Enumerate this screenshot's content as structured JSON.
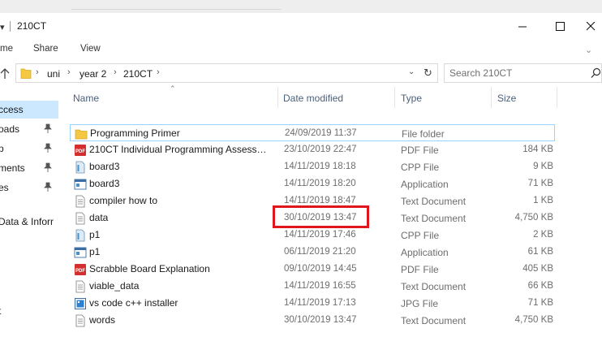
{
  "window": {
    "title": "210CT",
    "qa_arrow": "▾"
  },
  "ribbon": {
    "tabs": [
      "me",
      "Share",
      "View"
    ]
  },
  "address": {
    "crumbs": [
      "uni",
      "year 2",
      "210CT"
    ]
  },
  "search": {
    "placeholder": "Search 210CT"
  },
  "nav": {
    "items": [
      {
        "label": "ccess",
        "selected": true,
        "pinned": false
      },
      {
        "label": "oads",
        "selected": false,
        "pinned": true
      },
      {
        "label": "p",
        "selected": false,
        "pinned": true
      },
      {
        "label": "ments",
        "selected": false,
        "pinned": true
      },
      {
        "label": "es",
        "selected": false,
        "pinned": true
      },
      {
        "label": "Data & Inforr",
        "selected": false,
        "pinned": false
      },
      {
        "label": "t",
        "selected": false,
        "pinned": false
      }
    ]
  },
  "columns": {
    "name": "Name",
    "date": "Date modified",
    "type": "Type",
    "size": "Size"
  },
  "files": [
    {
      "name": "Programming Primer",
      "date": "24/09/2019 11:37",
      "type": "File folder",
      "size": "",
      "icon": "folder-icon"
    },
    {
      "name": "210CT Individual Programming Assessm...",
      "date": "23/10/2019 22:47",
      "type": "PDF File",
      "size": "184 KB",
      "icon": "pdf-icon"
    },
    {
      "name": "board3",
      "date": "14/11/2019 18:18",
      "type": "CPP File",
      "size": "9 KB",
      "icon": "cpp-file-icon"
    },
    {
      "name": "board3",
      "date": "14/11/2019 18:20",
      "type": "Application",
      "size": "71 KB",
      "icon": "application-icon"
    },
    {
      "name": "compiler how to",
      "date": "14/11/2019 18:47",
      "type": "Text Document",
      "size": "1 KB",
      "icon": "text-file-icon"
    },
    {
      "name": "data",
      "date": "30/10/2019 13:47",
      "type": "Text Document",
      "size": "4,750 KB",
      "icon": "text-file-icon"
    },
    {
      "name": "p1",
      "date": "14/11/2019 17:46",
      "type": "CPP File",
      "size": "2 KB",
      "icon": "cpp-file-icon"
    },
    {
      "name": "p1",
      "date": "06/11/2019 21:20",
      "type": "Application",
      "size": "61 KB",
      "icon": "application-icon"
    },
    {
      "name": "Scrabble Board Explanation",
      "date": "09/10/2019 14:45",
      "type": "PDF File",
      "size": "405 KB",
      "icon": "pdf-icon"
    },
    {
      "name": "viable_data",
      "date": "14/11/2019 16:55",
      "type": "Text Document",
      "size": "66 KB",
      "icon": "text-file-icon"
    },
    {
      "name": "vs code c++ installer",
      "date": "14/11/2019 17:13",
      "type": "JPG File",
      "size": "71 KB",
      "icon": "image-file-icon"
    },
    {
      "name": "words",
      "date": "30/10/2019 13:47",
      "type": "Text Document",
      "size": "4,750 KB",
      "icon": "text-file-icon"
    }
  ],
  "colors": {
    "selection": "#cce8ff",
    "focus_border": "#99d1ff",
    "header_text": "#4c607a",
    "annotation_red": "#e0151e",
    "pdf_red": "#d32f2f",
    "folder_yellow": "#f4c842"
  }
}
